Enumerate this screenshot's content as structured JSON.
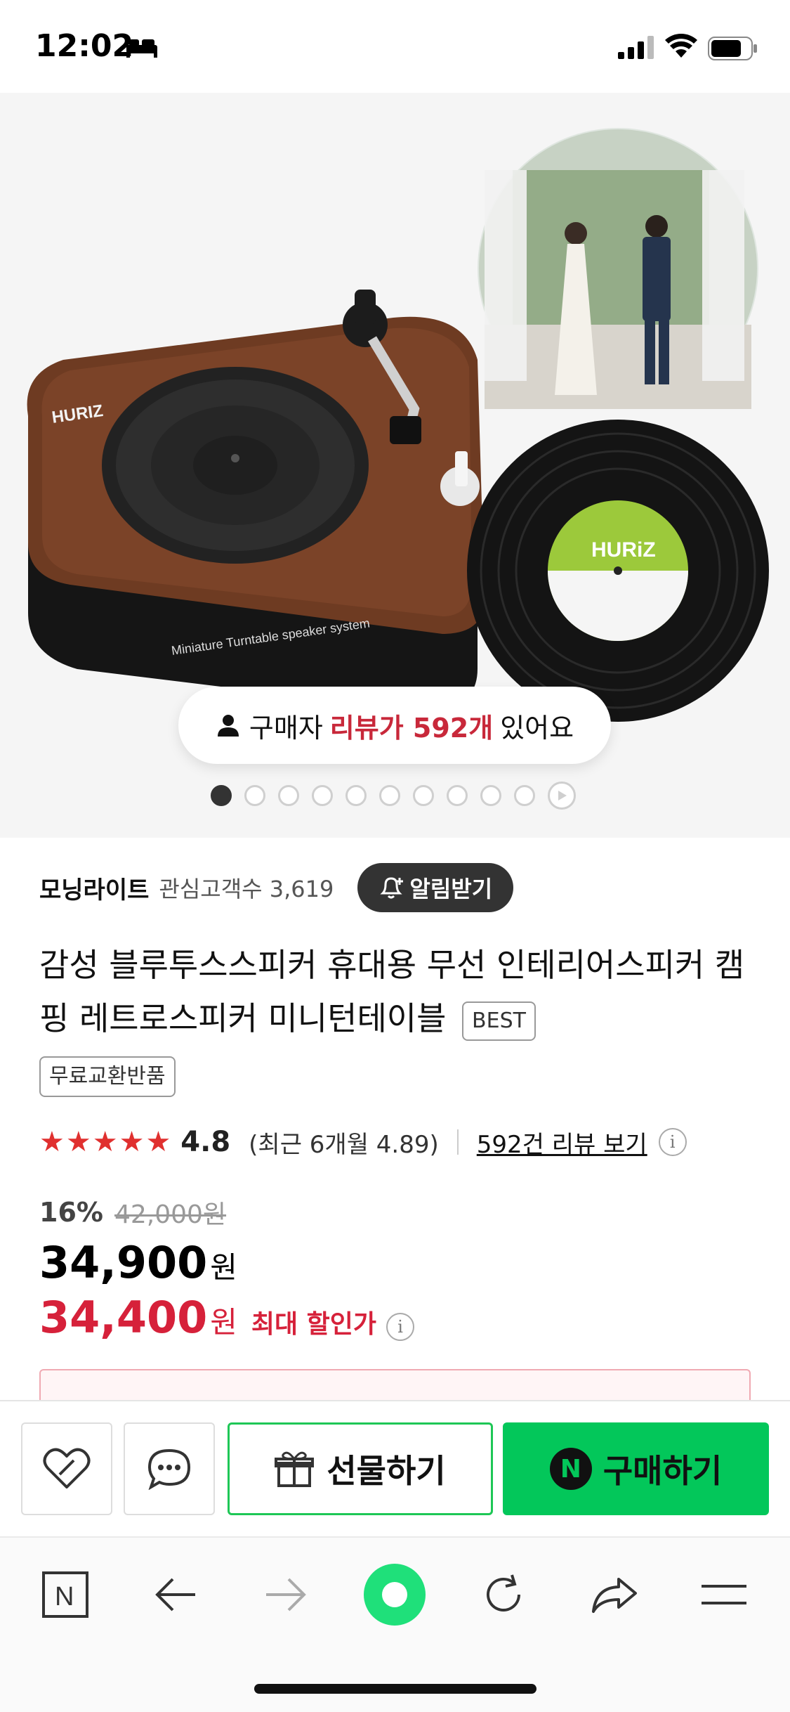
{
  "status_bar": {
    "time": "12:02",
    "icons": [
      "bed-icon",
      "signal-icon",
      "wifi-icon",
      "battery-icon"
    ]
  },
  "hero": {
    "brand_print": "HURIZ",
    "caption_print": "Miniature Turntable speaker system",
    "record_label": "HURiZ",
    "review_prefix": "구매자",
    "review_highlight": "리뷰가 592개",
    "review_suffix": "있어요",
    "carousel": {
      "total": 10,
      "active_index": 0
    }
  },
  "store": {
    "name": "모닝라이트",
    "fans_label": "관심고객수 3,619",
    "alarm_label": "알림받기"
  },
  "product": {
    "title": "감성 블루투스스피커 휴대용 무선 인테리어스피커 캠핑 레트로스피커 미니턴테이블",
    "best_badge": "BEST",
    "free_badge": "무료교환반품"
  },
  "rating": {
    "stars": "★★★★★",
    "score": "4.8",
    "recent": "(최근 6개월 4.89)",
    "review_link": "592건 리뷰 보기"
  },
  "price": {
    "discount": "16%",
    "original": "42,000원",
    "sale": "34,900",
    "sale_unit": "원",
    "max": "34,400",
    "max_unit": "원",
    "max_label": "최대 할인가"
  },
  "actions": {
    "gift_label": "선물하기",
    "buy_label": "구매하기",
    "buy_icon_letter": "N"
  },
  "browser": {
    "home_letter": "N"
  },
  "colors": {
    "accent_green": "#03c75a",
    "price_red": "#d6213a",
    "review_red": "#c8283a"
  }
}
